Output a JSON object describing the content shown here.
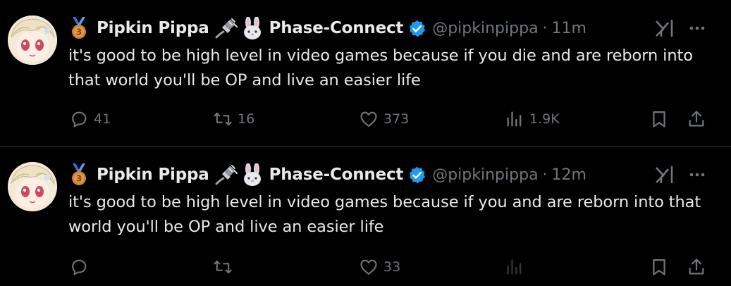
{
  "colors": {
    "background": "#000000",
    "text": "#e7e9ea",
    "secondary": "#71767b",
    "verified": "#1d9bf0",
    "divider": "#2f3336",
    "medal": "#cd7f32"
  },
  "tweets": [
    {
      "display_name": "Pipkin Pippa",
      "affiliation": "Phase-Connect",
      "handle": "@pipkinpippa",
      "separator": "·",
      "time": "11m",
      "text": "it's good to be high level in video games because if you die and are reborn into that world you'll be OP and live an easier life",
      "replies": "41",
      "retweets": "16",
      "likes": "373",
      "views": "1.9K",
      "icons": [
        "medal-icon",
        "plug-icon",
        "bunny-icon",
        "verified-icon",
        "grok-icon",
        "more-icon",
        "reply-icon",
        "retweet-icon",
        "like-icon",
        "views-icon",
        "bookmark-icon",
        "share-icon"
      ]
    },
    {
      "display_name": "Pipkin Pippa",
      "affiliation": "Phase-Connect",
      "handle": "@pipkinpippa",
      "separator": "·",
      "time": "12m",
      "text": "it's good to be high level in video games because if you and are reborn into that world you'll be OP and live an easier life",
      "replies": "",
      "retweets": "",
      "likes": "33",
      "views": "",
      "icons": [
        "medal-icon",
        "plug-icon",
        "bunny-icon",
        "verified-icon",
        "grok-icon",
        "more-icon",
        "reply-icon",
        "retweet-icon",
        "like-icon",
        "views-icon",
        "bookmark-icon",
        "share-icon"
      ]
    }
  ]
}
